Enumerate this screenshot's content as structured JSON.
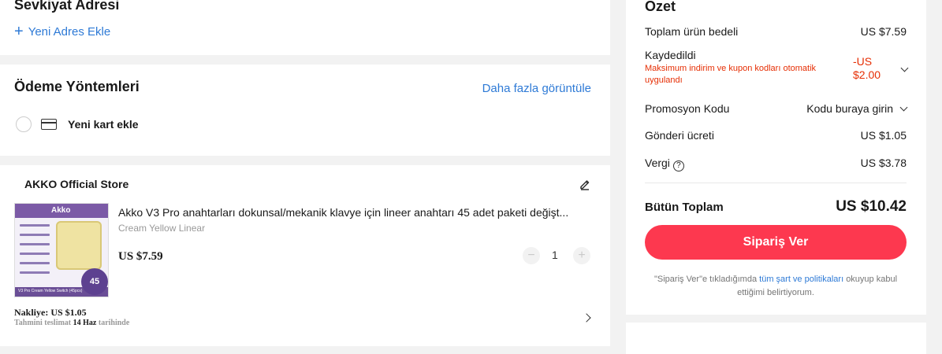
{
  "address": {
    "title": "Sevkiyat Adresi",
    "add_label": "Yeni Adres Ekle"
  },
  "payment": {
    "title": "Ödeme Yöntemleri",
    "more_label": "Daha fazla görüntüle",
    "add_card_label": "Yeni kart ekle"
  },
  "store": {
    "name": "AKKO Official Store",
    "product": {
      "title": "Akko V3 Pro anahtarları dokunsal/mekanik klavye için lineer anahtarı 45 adet paketi değişt...",
      "variant": "Cream Yellow Linear",
      "price": "US $7.59",
      "quantity": "1",
      "image_brand": "Akko",
      "image_badge": "45",
      "image_caption": "V3 Pro Cream Yellow Switch (45pcs)"
    },
    "shipping": {
      "label": "Nakliye: US $1.05",
      "eta_prefix": "Tahmini teslimat",
      "eta_date": "14 Haz",
      "eta_suffix": "tarihinde"
    }
  },
  "summary": {
    "title": "Özet",
    "items_label": "Toplam ürün bedeli",
    "items_value": "US $7.59",
    "saved_label": "Kaydedildi",
    "saved_note": "Maksimum indirim ve kupon kodları otomatik uygulandı",
    "saved_value": "-US $2.00",
    "promo_label": "Promosyon Kodu",
    "promo_value": "Kodu buraya girin",
    "shipping_label": "Gönderi ücreti",
    "shipping_value": "US $1.05",
    "tax_label": "Vergi",
    "tax_value": "US $3.78",
    "total_label": "Bütün Toplam",
    "total_value": "US $10.42",
    "order_button": "Sipariş Ver",
    "terms_prefix": "\"Sipariş Ver\"e tıkladığımda",
    "terms_link": "tüm şart ve politikaları",
    "terms_suffix": "okuyup kabul ettiğimi belirtiyorum."
  },
  "colors": {
    "accent_blue": "#2e7ad6",
    "cta_red": "#fd384f",
    "discount_red": "#e62e04"
  }
}
